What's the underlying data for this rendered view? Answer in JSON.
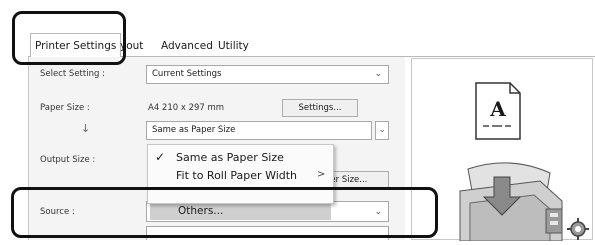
{
  "tabs": [
    {
      "label": "Printer Settings"
    },
    {
      "label": "yout"
    },
    {
      "label": "Advanced"
    },
    {
      "label": "Utility"
    }
  ],
  "settings": {
    "select_setting": {
      "label": "Select Setting :",
      "value": "Current Settings"
    },
    "paper_size": {
      "label": "Paper Size :",
      "value": "A4 210 x 297 mm",
      "button": "Settings...",
      "arrow": "↓"
    },
    "output_combo": {
      "value": "Same as Paper Size"
    },
    "output_size": {
      "label": "Output Size :",
      "button_partial": "per Size..."
    },
    "source": {
      "label": "Source :"
    }
  },
  "dropdown_menu": {
    "items": [
      {
        "label": "Same as Paper Size",
        "checked": true,
        "check": "✓"
      },
      {
        "label": "Fit to Roll Paper Width",
        "submenu": ">"
      }
    ],
    "others_item": "Others..."
  },
  "preview": {
    "page_letter": "A"
  },
  "icons": [
    "chevron-down-icon",
    "check-icon",
    "submenu-arrow-icon",
    "paper-preview-icon",
    "printer-icon",
    "gear-icon"
  ],
  "colors": {
    "callout": "#111111",
    "panel": "#f4f4f4",
    "highlight": "#cfcfcf"
  }
}
